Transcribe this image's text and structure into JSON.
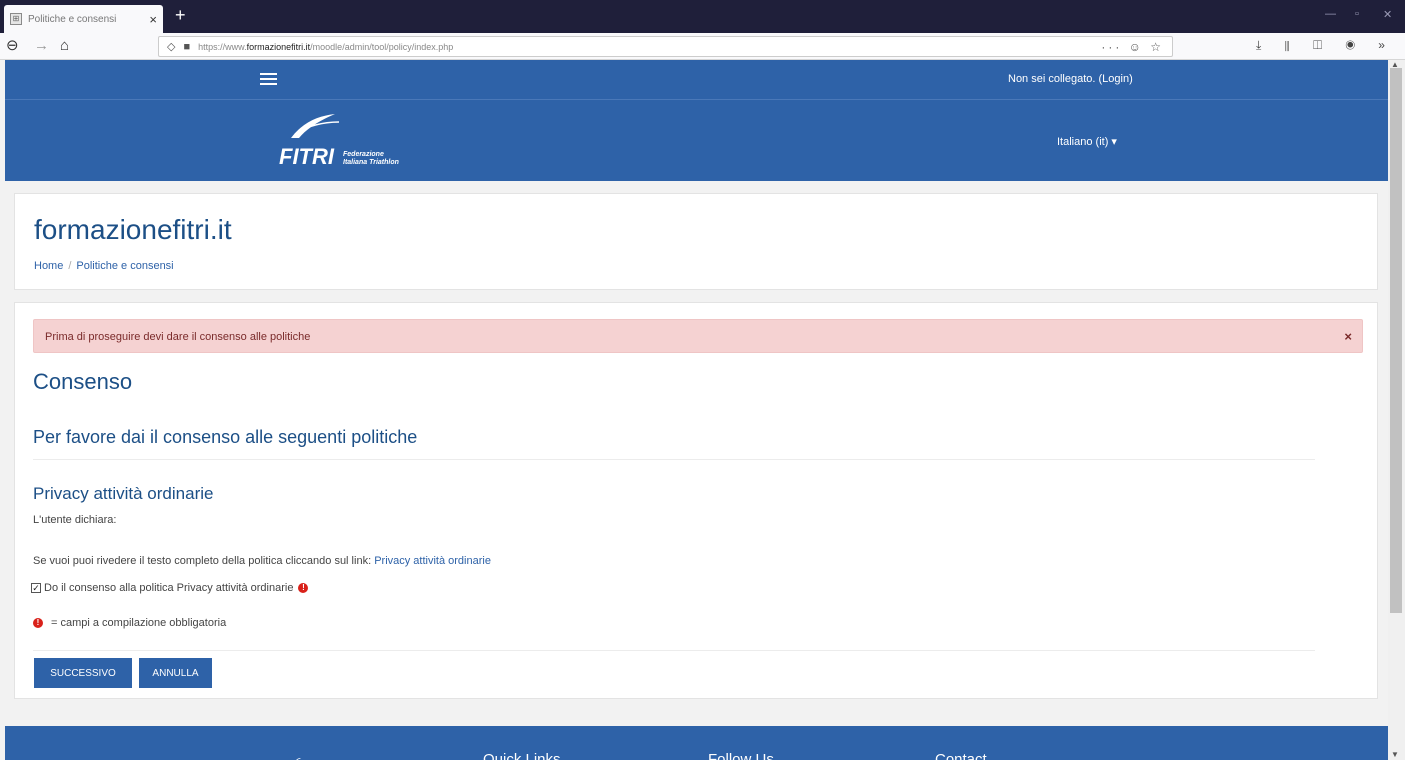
{
  "browser": {
    "tab_title": "Politiche e consensi",
    "tab_close": "×",
    "new_tab": "+",
    "url_prefix": "https://www.",
    "url_domain": "formazionefitri.it",
    "url_path": "/moodle/admin/tool/policy/index.php",
    "url_actions": "··· ☺ ☆"
  },
  "page": {
    "login_text": "Non sei collegato. (Login)",
    "language": "Italiano (it) ▾",
    "logo_text": "FITRI",
    "logo_sub1": "Federazione",
    "logo_sub2": "Italiana Triathlon",
    "site_title": "formazionefitri.it",
    "breadcrumb": {
      "home": "Home",
      "sep": "/",
      "current": "Politiche e consensi"
    }
  },
  "main": {
    "alert_text": "Prima di proseguire devi dare il consenso alle politiche",
    "alert_close": "×",
    "heading": "Consenso",
    "subheading": "Per favore dai il consenso alle seguenti politiche",
    "policy_title": "Privacy attività ordinarie",
    "policy_intro": "L'utente dichiara:",
    "review_text": "Se vuoi puoi rivedere il testo completo della politica cliccando sul link: ",
    "review_link": "Privacy attività ordinarie",
    "consent_label": "Do il consenso alla politica Privacy attività ordinarie",
    "consent_checked": true,
    "required_note": "= campi a compilazione obbligatoria",
    "btn_next": "SUCCESSIVO",
    "btn_cancel": "ANNULLA"
  },
  "footer": {
    "quick_links": "Quick Links",
    "follow_us": "Follow Us",
    "contact": "Contact"
  },
  "colors": {
    "primary": "#2e62a8",
    "heading": "#1c4f86",
    "alert_bg": "#f5d2d2",
    "required": "#d9211a"
  }
}
